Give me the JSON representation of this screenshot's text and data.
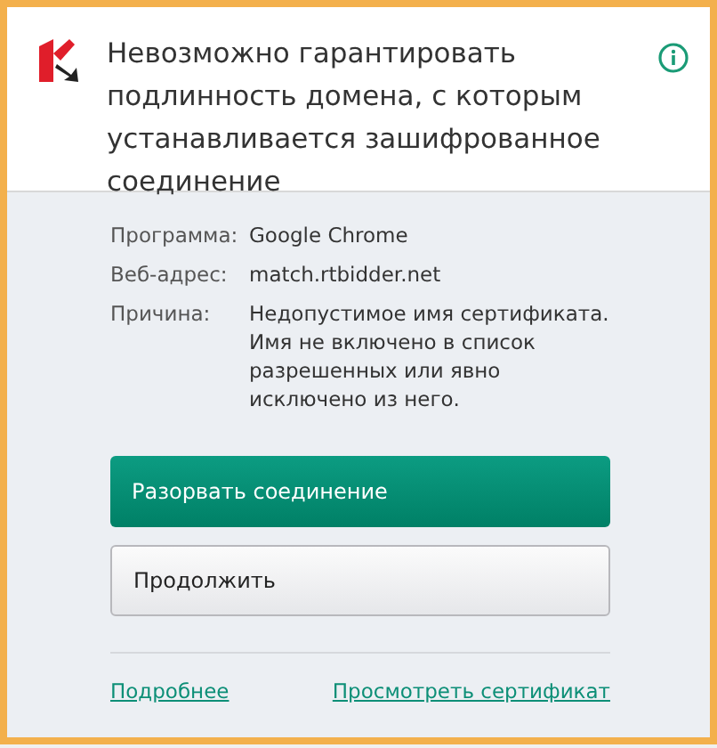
{
  "header": {
    "title": "Невозможно гарантировать подлинность домена, с которым устанавливается зашифрованное соединение"
  },
  "details": [
    {
      "label": "Программа:",
      "value": "Google Chrome"
    },
    {
      "label": "Веб-адрес:",
      "value": "match.rtbidder.net"
    },
    {
      "label": "Причина:",
      "value": "Недопустимое имя сертификата. Имя не включено в список разрешенных или явно исключено из него."
    }
  ],
  "buttons": [
    {
      "label": "Разорвать соединение",
      "kind": "primary"
    },
    {
      "label": "Продолжить",
      "kind": "secondary"
    }
  ],
  "links": [
    "Подробнее",
    "Просмотреть сертификат"
  ]
}
